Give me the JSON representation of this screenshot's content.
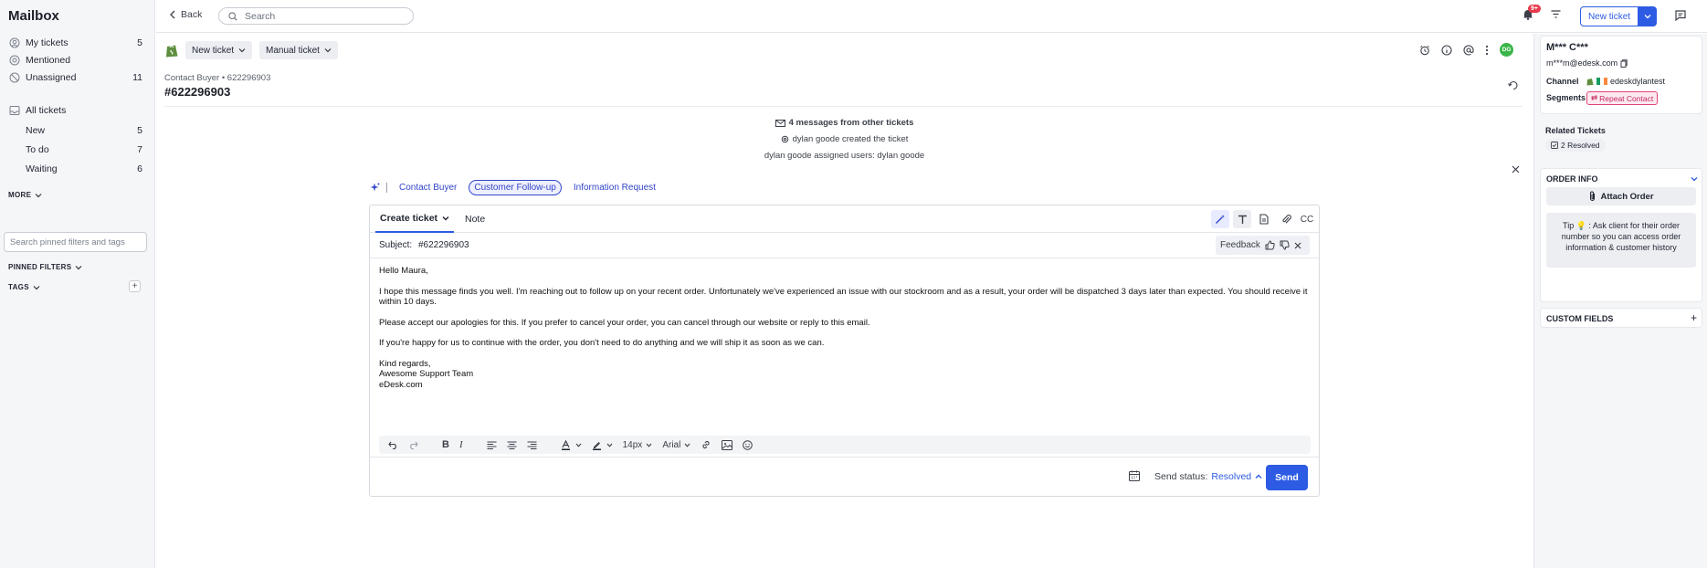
{
  "sidebar": {
    "title": "Mailbox",
    "items": [
      {
        "label": "My tickets",
        "count": "5"
      },
      {
        "label": "Mentioned",
        "count": ""
      },
      {
        "label": "Unassigned",
        "count": "11"
      },
      {
        "label": "All tickets",
        "count": ""
      },
      {
        "label": "New",
        "count": "5"
      },
      {
        "label": "To do",
        "count": "7"
      },
      {
        "label": "Waiting",
        "count": "6"
      }
    ],
    "more_label": "MORE",
    "search_placeholder": "Search pinned filters and tags",
    "pinned_filters_label": "PINNED FILTERS",
    "tags_label": "TAGS"
  },
  "topbar": {
    "back_label": "Back",
    "search_placeholder": "Search",
    "notification_badge": "9+",
    "new_ticket_label": "New ticket"
  },
  "ticket_toolbar": {
    "new_ticket_label": "New ticket",
    "manual_ticket_label": "Manual ticket",
    "avatar_initials": "DG"
  },
  "ticket": {
    "meta": "Contact Buyer • 622296903",
    "number": "#622296903",
    "events": [
      "4 messages from other tickets",
      "dylan goode created the ticket",
      "dylan goode assigned users: dylan goode"
    ]
  },
  "ai_suggestions": [
    "Contact Buyer",
    "Customer Follow-up",
    "Information Request"
  ],
  "compose": {
    "tabs": [
      "Create ticket",
      "Note"
    ],
    "cc_label": "CC",
    "subject_label": "Subject:",
    "subject_value": "#622296903",
    "feedback_label": "Feedback",
    "body": [
      "Hello Maura,",
      "I hope this message finds you well. I'm reaching out to follow up on your recent order. Unfortunately we've experienced an issue with our stockroom and as a result, your order will be dispatched 3 days later than expected. You should receive it within 10 days.",
      "Please accept our apologies for this. If you prefer to cancel your order, you can cancel through our website or reply to this email.",
      "If you're happy for us to continue with the order, you don't need to do anything and we will ship it as soon as we can.",
      "Kind regards,",
      "Awesome Support Team",
      "eDesk.com"
    ],
    "font_size": "14px",
    "font_family": "Arial",
    "send_status_label": "Send status:",
    "send_status_value": "Resolved",
    "send_label": "Send"
  },
  "customer": {
    "name": "M*** C***",
    "email": "m***m@edesk.com",
    "channel_label": "Channel",
    "channel_value": "edeskdylantest",
    "segments_label": "Segments",
    "segment_value": "Repeat Contact"
  },
  "related_tickets": {
    "title": "Related Tickets",
    "resolved_label": "2 Resolved"
  },
  "order_info": {
    "title": "ORDER INFO",
    "attach_label": "Attach Order",
    "tip_text": "Tip 💡 : Ask client for their order number so you can access order information & customer history"
  },
  "custom_fields": {
    "title": "CUSTOM FIELDS"
  },
  "colors": {
    "accent": "#2d5be3",
    "avatar": "#3bb54a",
    "badge": "#e5384b",
    "segment": "#c3245f"
  }
}
